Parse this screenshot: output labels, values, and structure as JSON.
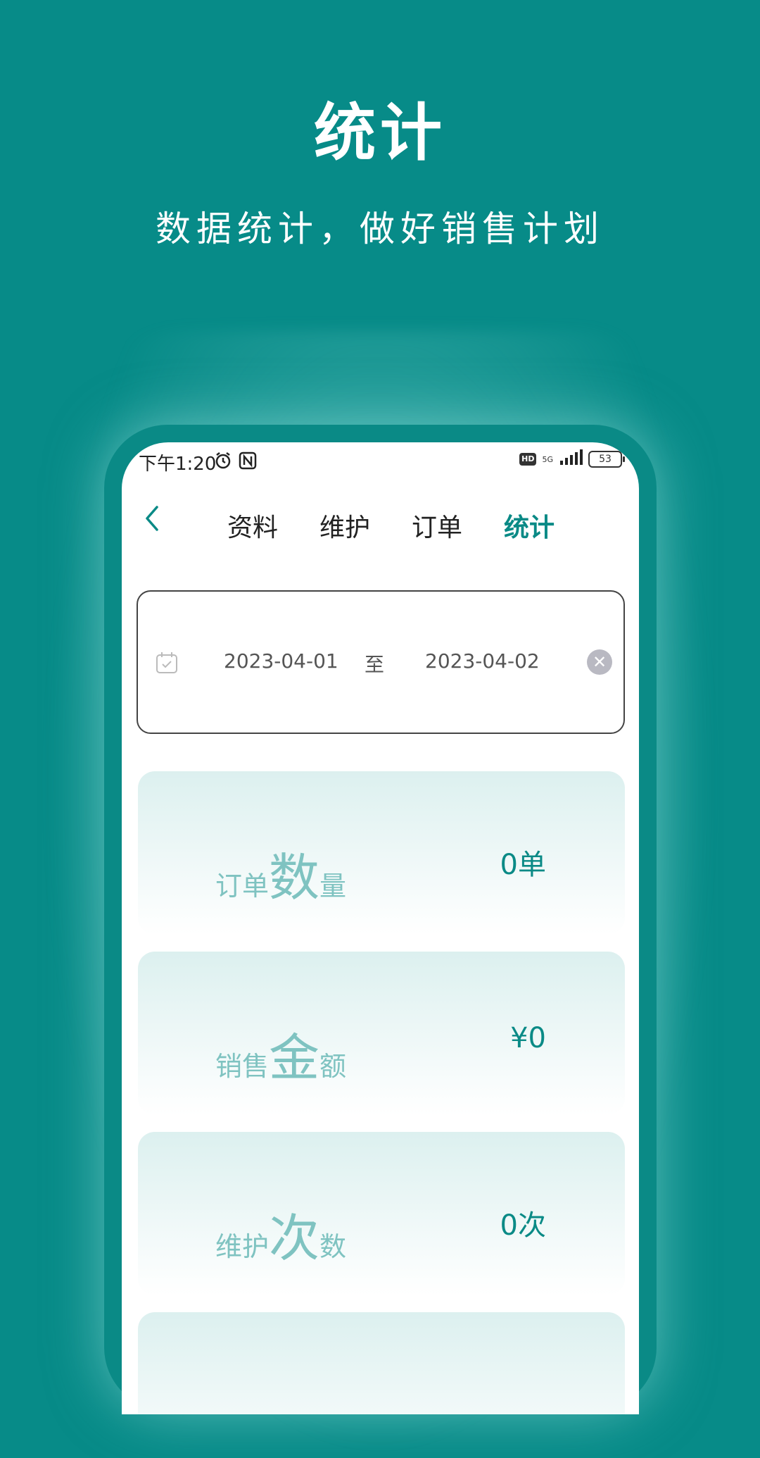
{
  "hero": {
    "title": "统计",
    "subtitle": "数据统计，做好销售计划"
  },
  "status_bar": {
    "time": "下午1:20",
    "hd": "HD",
    "network": "5G",
    "battery": "53"
  },
  "nav": {
    "tabs": [
      {
        "label": "资料",
        "active": false
      },
      {
        "label": "维护",
        "active": false
      },
      {
        "label": "订单",
        "active": false
      },
      {
        "label": "统计",
        "active": true
      }
    ]
  },
  "date_range": {
    "start": "2023-04-01",
    "separator": "至",
    "end": "2023-04-02"
  },
  "stats": [
    {
      "label_pre": "订单",
      "label_big": "数",
      "label_post": "量",
      "value": "0单"
    },
    {
      "label_pre": "销售",
      "label_big": "金",
      "label_post": "额",
      "value": "¥0"
    },
    {
      "label_pre": "维护",
      "label_big": "次",
      "label_post": "数",
      "value": "0次"
    }
  ],
  "colors": {
    "brand": "#078b88",
    "accent_text": "#0a8a86",
    "label_light": "#7fc3c1"
  }
}
